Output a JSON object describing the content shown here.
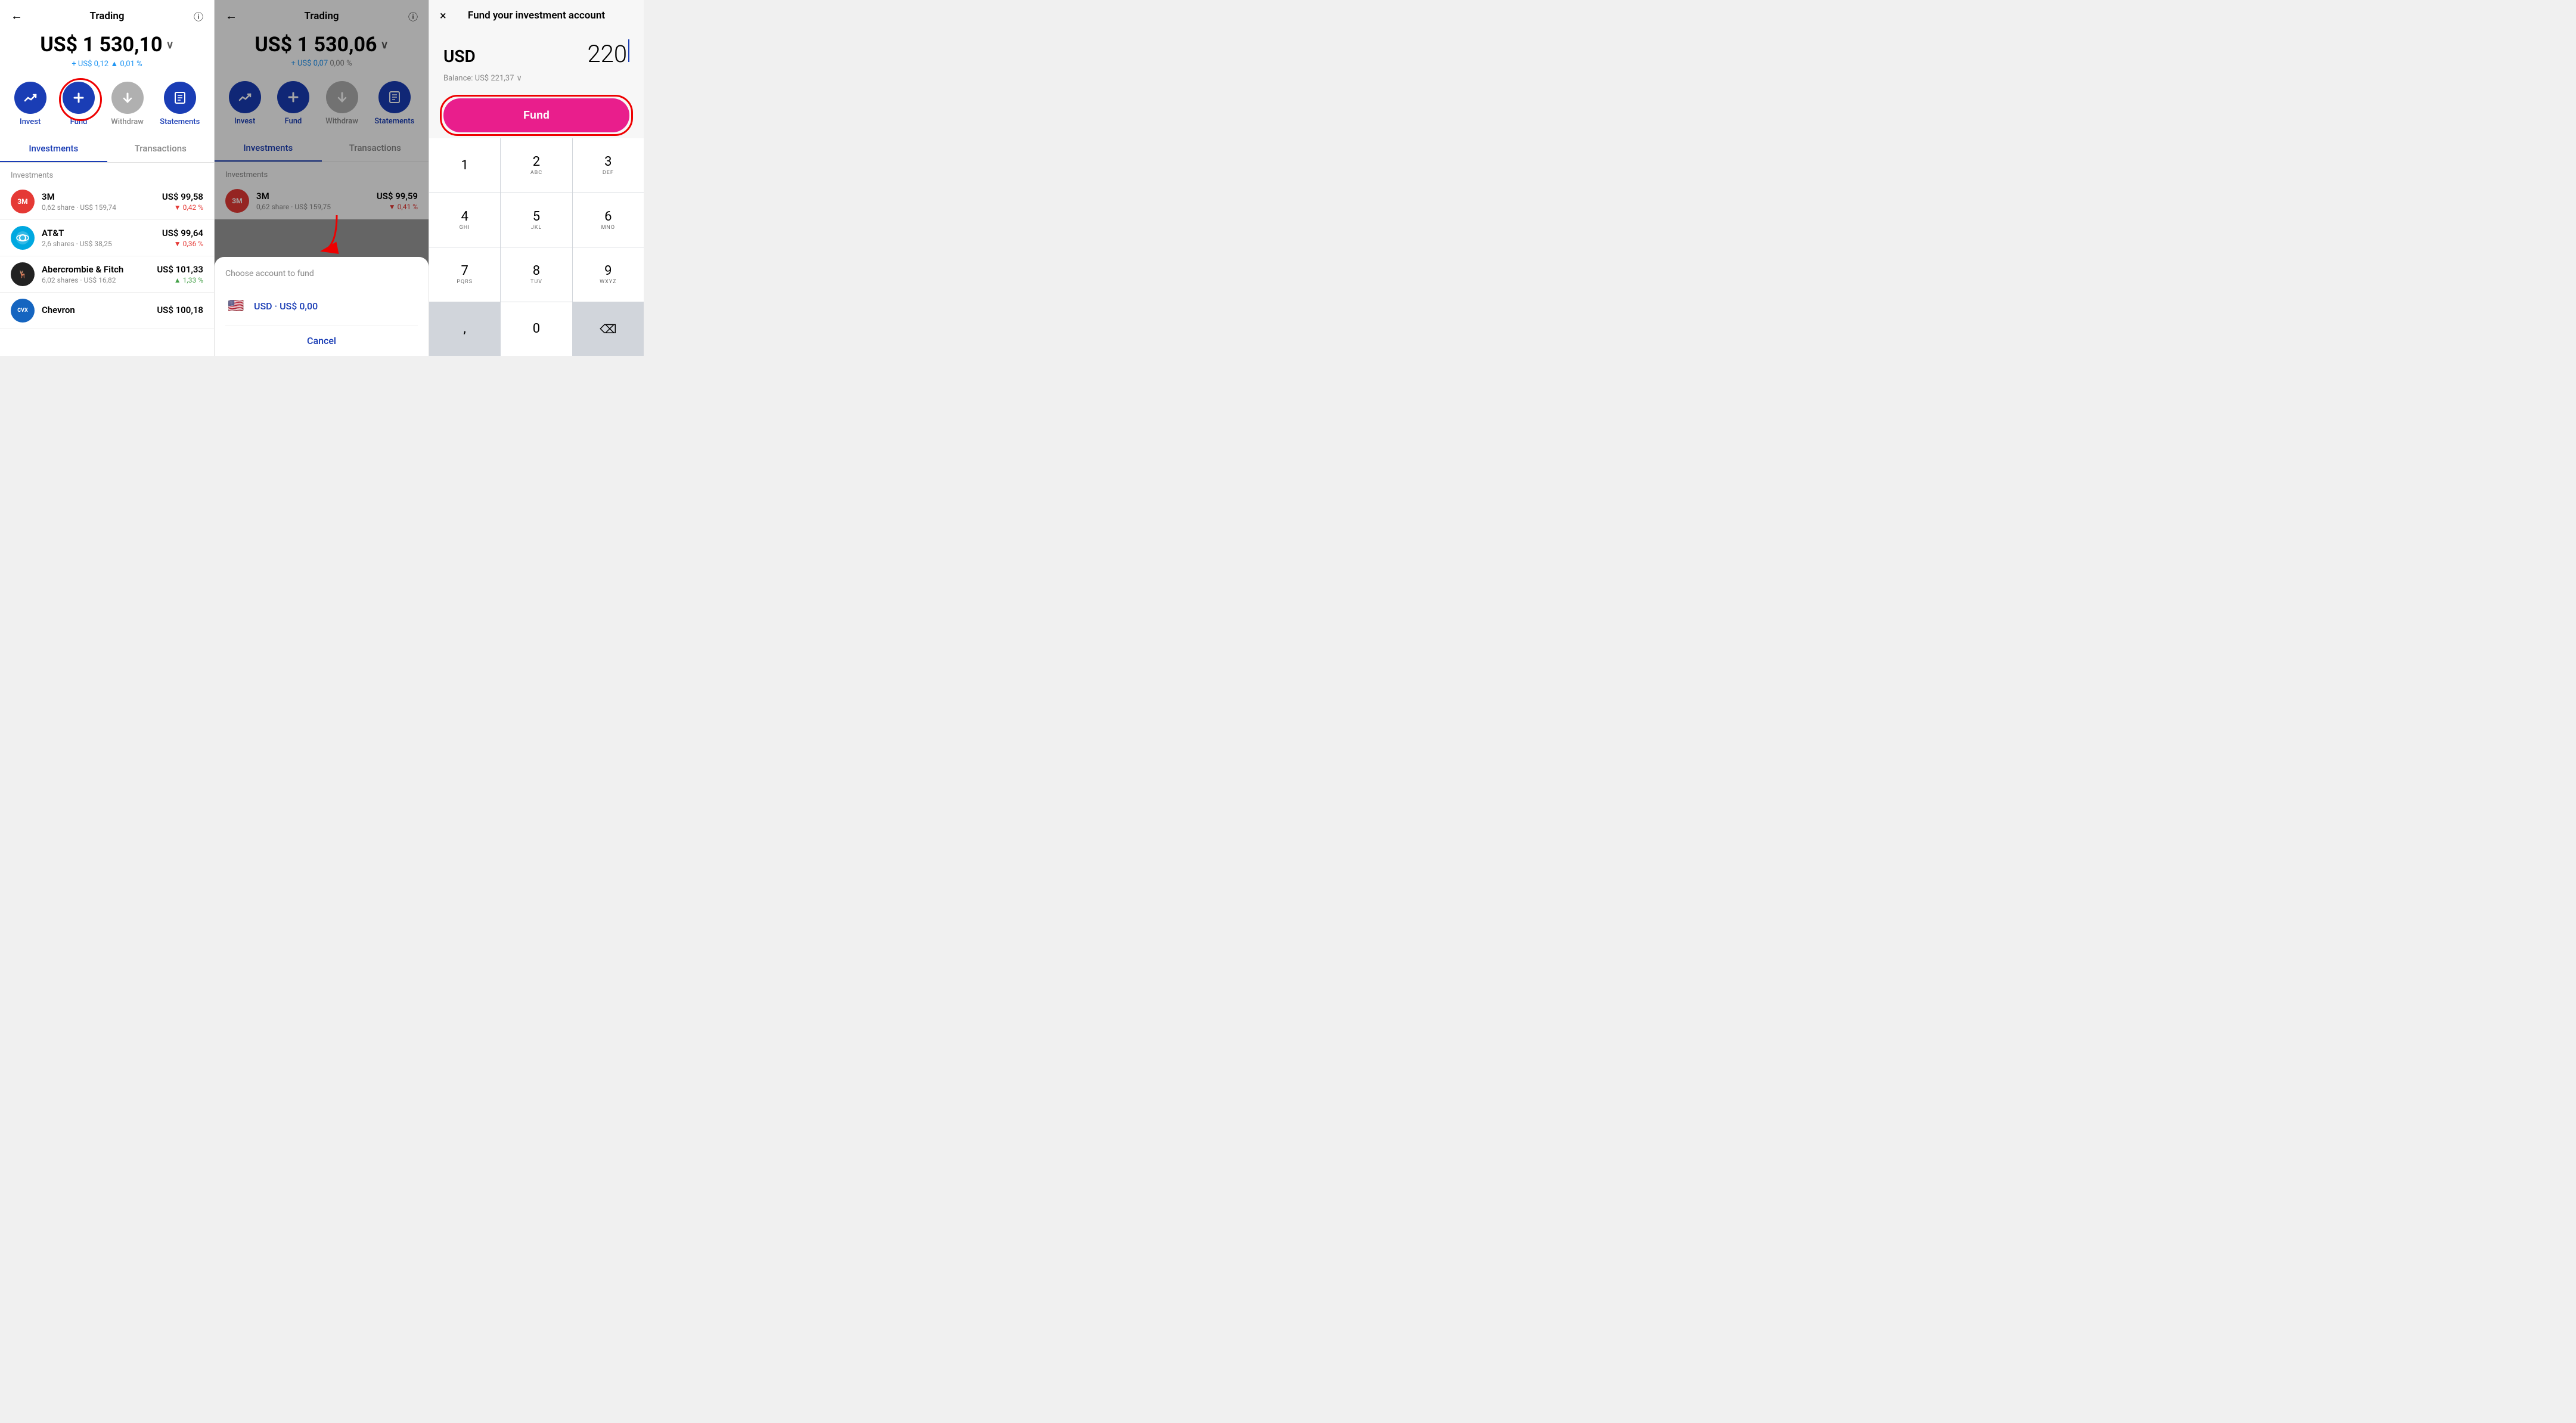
{
  "panel1": {
    "header": {
      "back": "←",
      "title": "Trading",
      "info": "ⓘ"
    },
    "balance": {
      "amount": "US$ 1 530,10",
      "chevron": "∨",
      "change_prefix": "+ US$ 0,12",
      "change_pct": "▲ 0,01 %"
    },
    "actions": [
      {
        "id": "invest",
        "label": "Invest",
        "icon": "📊",
        "active": true
      },
      {
        "id": "fund",
        "label": "Fund",
        "icon": "+",
        "active": true,
        "highlighted": true
      },
      {
        "id": "withdraw",
        "label": "Withdraw",
        "icon": "↓",
        "active": false
      },
      {
        "id": "statements",
        "label": "Statements",
        "icon": "≡",
        "active": true
      }
    ],
    "tabs": [
      {
        "id": "investments",
        "label": "Investments",
        "active": true
      },
      {
        "id": "transactions",
        "label": "Transactions",
        "active": false
      }
    ],
    "section_label": "Investments",
    "investments": [
      {
        "id": "3m",
        "name": "3M",
        "sub": "0,62 share · US$ 159,74",
        "amount": "US$ 99,58",
        "change": "▼ 0,42 %",
        "direction": "down",
        "color": "#e53935",
        "symbol": "3M"
      },
      {
        "id": "att",
        "name": "AT&T",
        "sub": "2,6 shares · US$ 38,25",
        "amount": "US$ 99,64",
        "change": "▼ 0,36 %",
        "direction": "down",
        "color": "#00a8e0",
        "symbol": "AT&T"
      },
      {
        "id": "abercrombie",
        "name": "Abercrombie & Fitch",
        "sub": "6,02 shares · US$ 16,82",
        "amount": "US$ 101,33",
        "change": "▲ 1,33 %",
        "direction": "up",
        "color": "#222",
        "symbol": "🦌"
      },
      {
        "id": "chevron",
        "name": "Chevron",
        "sub": "",
        "amount": "US$ 100,18",
        "change": "",
        "direction": "neutral",
        "color": "#1565c0",
        "symbol": "CVX"
      }
    ]
  },
  "panel2": {
    "header": {
      "back": "←",
      "title": "Trading",
      "info": "ⓘ"
    },
    "balance": {
      "amount": "US$ 1 530,06",
      "chevron": "∨",
      "change_prefix": "+ US$ 0,07",
      "change_pct": "0,00 %"
    },
    "actions": [
      {
        "id": "invest",
        "label": "Invest",
        "icon": "📊",
        "active": true
      },
      {
        "id": "fund",
        "label": "Fund",
        "icon": "+",
        "active": true
      },
      {
        "id": "withdraw",
        "label": "Withdraw",
        "icon": "↓",
        "active": false
      },
      {
        "id": "statements",
        "label": "Statements",
        "icon": "≡",
        "active": true
      }
    ],
    "tabs": [
      {
        "id": "investments",
        "label": "Investments",
        "active": true
      },
      {
        "id": "transactions",
        "label": "Transactions",
        "active": false
      }
    ],
    "section_label": "Investments",
    "investments": [
      {
        "id": "3m",
        "name": "3M",
        "sub": "0,62 share · US$ 159,75",
        "amount": "US$ 99,59",
        "change": "▼ 0,41 %",
        "direction": "down",
        "color": "#e53935",
        "symbol": "3M"
      }
    ],
    "modal": {
      "title": "Choose account to fund",
      "option": "USD · US$ 0,00",
      "cancel": "Cancel"
    }
  },
  "panel3": {
    "header": {
      "close": "×",
      "title": "Fund your investment account"
    },
    "currency": "USD",
    "amount": "220",
    "balance_label": "Balance: US$ 221,37",
    "balance_chevron": "∨",
    "fund_button_label": "Fund",
    "keypad": [
      {
        "main": "1",
        "sub": ""
      },
      {
        "main": "2",
        "sub": "ABC"
      },
      {
        "main": "3",
        "sub": "DEF"
      },
      {
        "main": "4",
        "sub": "GHI"
      },
      {
        "main": "5",
        "sub": "JKL"
      },
      {
        "main": "6",
        "sub": "MNO"
      },
      {
        "main": "7",
        "sub": "PQRS"
      },
      {
        "main": "8",
        "sub": "TUV"
      },
      {
        "main": "9",
        "sub": "WXYZ"
      },
      {
        "main": ",",
        "sub": ""
      },
      {
        "main": "0",
        "sub": ""
      },
      {
        "main": "⌫",
        "sub": "",
        "type": "delete"
      }
    ]
  }
}
